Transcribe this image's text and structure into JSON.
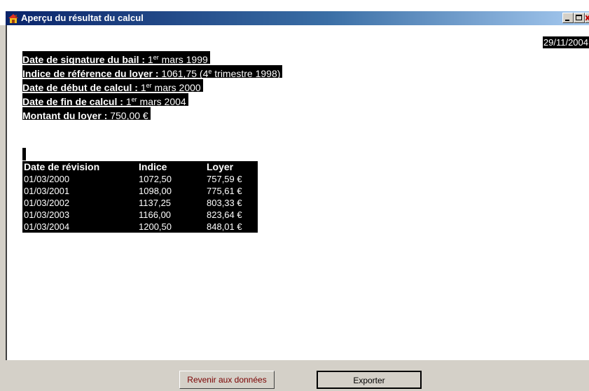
{
  "window": {
    "title": "Aperçu du résultat du calcul"
  },
  "report": {
    "date": "29/11/2004",
    "lines": [
      {
        "label": "Date de signature du bail :",
        "value_pre": " 1",
        "sup": "er",
        "value_post": " mars 1999"
      },
      {
        "label": "Indice de référence du loyer :",
        "value_pre": " 1061,75 (4",
        "sup": "e",
        "value_post": " trimestre 1998)"
      },
      {
        "label": "Date de début de calcul :",
        "value_pre": " 1",
        "sup": "er",
        "value_post": " mars 2000"
      },
      {
        "label": "Date de fin de calcul :",
        "value_pre": " 1",
        "sup": "er",
        "value_post": " mars 2004"
      },
      {
        "label": "Montant du loyer :",
        "value_pre": " 750,00 €",
        "sup": "",
        "value_post": ""
      }
    ],
    "table": {
      "headers": [
        "Date de révision",
        "Indice",
        "Loyer"
      ],
      "rows": [
        [
          "01/03/2000",
          "1072,50",
          "757,59 €"
        ],
        [
          "01/03/2001",
          "1098,00",
          "775,61 €"
        ],
        [
          "01/03/2002",
          "1137,25",
          "803,33 €"
        ],
        [
          "01/03/2003",
          "1166,00",
          "823,64 €"
        ],
        [
          "01/03/2004",
          "1200,50",
          "848,01 €"
        ]
      ]
    }
  },
  "footer": {
    "return_label": "Revenir aux données",
    "export_label": "Exporter"
  }
}
